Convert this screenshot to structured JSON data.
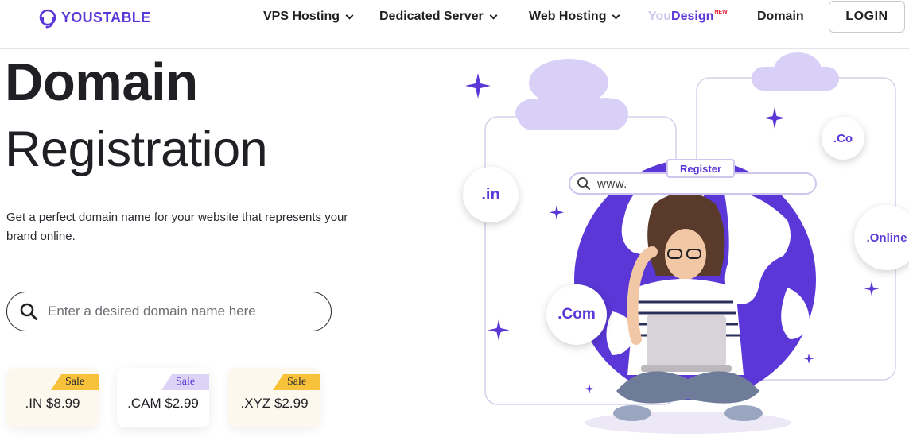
{
  "brand": {
    "name": "YOUSTABLE",
    "color": "#5a37d6"
  },
  "nav": {
    "vps": "VPS Hosting",
    "dedicated": "Dedicated Server",
    "web": "Web Hosting",
    "youdesign_you": "You",
    "youdesign_design": "Design",
    "youdesign_badge": "NEW",
    "domain": "Domain",
    "login": "LOGIN"
  },
  "hero": {
    "title_line1": "Domain",
    "title_line2": "Registration",
    "description": "Get a perfect domain name for your website that represents your brand online."
  },
  "search": {
    "placeholder": "Enter a desired domain name here",
    "value": ""
  },
  "price_cards": [
    {
      "badge": "Sale",
      "label": ".IN $8.99"
    },
    {
      "badge": "Sale",
      "label": ".CAM $2.99"
    },
    {
      "badge": "Sale",
      "label": ".XYZ $2.99"
    }
  ],
  "illustration": {
    "tlds": {
      "in": ".in",
      "co": ".Co",
      "online": ".Online",
      "com": ".Com"
    },
    "www_text": "www.",
    "register_label": "Register"
  },
  "colors": {
    "accent": "#5a37d6",
    "lavender": "#cfc6ee",
    "sale_gold": "#f7c13a",
    "card_cream": "#fdf8ee"
  }
}
